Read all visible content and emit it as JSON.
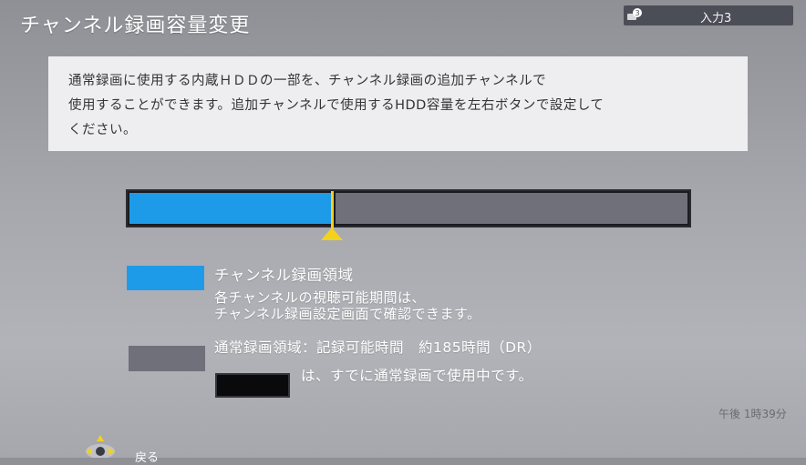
{
  "screen": {
    "title": "チャンネル録画容量変更"
  },
  "input_badge": {
    "notification_count": "3",
    "label": "入力3"
  },
  "notice": {
    "lines": [
      "通常録画に使用する内蔵ＨＤＤの一部を、チャンネル録画の追加チャンネルで",
      "使用することができます。追加チャンネルで使用するHDD容量を左右ボタンで設定して",
      "ください。"
    ]
  },
  "capacity": {
    "channel_fraction": 0.362
  },
  "legend": {
    "channel_title": "チャンネル録画領域",
    "channel_desc_1": "各チャンネルの視聴可能期間は、",
    "channel_desc_2": "チャンネル録画設定画面で確認できます。",
    "normal_text": "通常録画領域：記録可能時間　約185時間（DR）",
    "used_text": "は、すでに通常録画で使用中です。"
  },
  "status": {
    "clock": "午後 1時39分"
  },
  "nav": {
    "back_label": "戻る"
  },
  "colors": {
    "channel_area": "#1e9be8",
    "normal_area": "#6f7079",
    "used_area": "#0a0a0c",
    "slider": "#f2d21d"
  }
}
